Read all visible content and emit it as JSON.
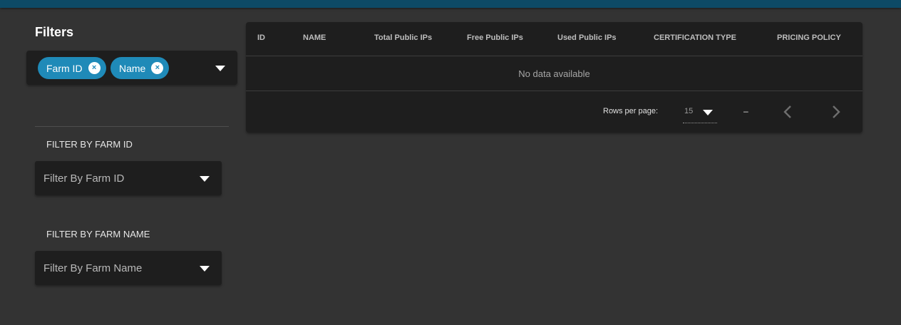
{
  "filters": {
    "title": "Filters",
    "chips": [
      {
        "label": "Farm ID"
      },
      {
        "label": "Name"
      }
    ],
    "chip_remove_glyph": "×",
    "sections": [
      {
        "label": "FILTER BY FARM ID",
        "placeholder": "Filter By Farm ID"
      },
      {
        "label": "FILTER BY FARM NAME",
        "placeholder": "Filter By Farm Name"
      }
    ]
  },
  "table": {
    "headers": [
      "ID",
      "NAME",
      "Total Public IPs",
      "Free Public IPs",
      "Used Public IPs",
      "CERTIFICATION TYPE",
      "PRICING POLICY"
    ],
    "empty_text": "No data available",
    "footer": {
      "rows_per_page_label": "Rows per page:",
      "rows_per_page_value": "15",
      "page_range": "–"
    }
  },
  "icons": {
    "dropdown": "chevron-down-icon",
    "prev": "chevron-left-icon",
    "next": "chevron-right-icon",
    "chip_remove": "close-icon"
  },
  "colors": {
    "topbar": "#0d4a66",
    "background": "#333333",
    "card": "#1e1e1e",
    "chip": "#1f8ab8"
  }
}
